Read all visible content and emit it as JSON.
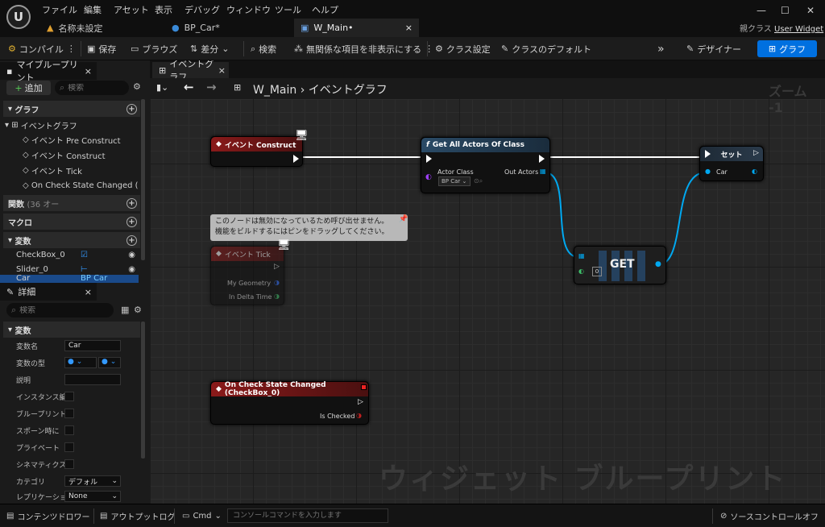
{
  "menu": [
    "ファイル",
    "編集",
    "アセット",
    "表示",
    "デバッグ",
    "ウィンドウ",
    "ツール",
    "ヘルプ"
  ],
  "tabs": {
    "project": "名称未設定",
    "bp_car": "BP_Car*",
    "w_main": "W_Main•"
  },
  "parent": {
    "label": "親クラス",
    "value": "User Widget"
  },
  "toolbar": {
    "compile": "コンパイル",
    "save": "保存",
    "browse": "ブラウズ",
    "diff": "差分",
    "find": "検索",
    "hide_unrelated": "無関係な項目を非表示にする",
    "class_settings": "クラス設定",
    "class_defaults": "クラスのデフォルト",
    "designer": "デザイナー",
    "graph": "グラフ"
  },
  "mybp": {
    "tab": "マイブループリント",
    "add": "追加",
    "search_placeholder": "検索",
    "graphs_header": "グラフ",
    "event_graph": "イベントグラフ",
    "events": [
      "イベント Pre Construct",
      "イベント Construct",
      "イベント Tick",
      "On Check State Changed (Chec"
    ],
    "functions": "関数",
    "functions_count": "(36 オー",
    "macros": "マクロ",
    "variables": "変数",
    "vars": [
      "CheckBox_0",
      "Slider_0",
      "Car"
    ],
    "car_type": "BP Car"
  },
  "details": {
    "tab": "詳細",
    "search_placeholder": "検索",
    "section": "変数",
    "props": [
      "変数名",
      "変数の型",
      "説明",
      "インスタンス編",
      "ブループリント",
      "スポーン時に",
      "プライベート",
      "シネマティクス",
      "カテゴリ",
      "レプリケーショ"
    ],
    "var_name": "Car",
    "category_value": "デフォル",
    "replication_value": "None"
  },
  "graph": {
    "tab": "イベントグラフ",
    "crumb_root": "W_Main",
    "crumb_leaf": "イベントグラフ",
    "zoom": "ズーム -1",
    "watermark": "ウィジェット ブループリント",
    "node_construct": "イベント Construct",
    "node_getall": "Get All Actors Of Class",
    "actor_class": "Actor Class",
    "out_actors": "Out Actors",
    "bp_car": "BP Car",
    "node_set": "セット",
    "car_pin": "Car",
    "node_get": "GET",
    "get_index": "0",
    "tooltip": "このノードは無効になっているため呼び出せません。\n機能をビルドするにはピンをドラッグしてください。",
    "node_tick": "イベント Tick",
    "my_geometry": "My Geometry",
    "in_delta_time": "In Delta Time",
    "node_check": "On Check State Changed (CheckBox_0)",
    "is_checked": "Is Checked"
  },
  "status": {
    "content_drawer": "コンテンツドロワー",
    "output_log": "アウトプットログ",
    "cmd": "Cmd",
    "console_placeholder": "コンソールコマンドを入力します",
    "source_control": "ソースコントロールオフ"
  },
  "colors": {
    "accent": "#0070e0",
    "event_red": "#8a1a1a",
    "function_blue": "#2a4a66",
    "object_pin": "#00a8f0"
  }
}
